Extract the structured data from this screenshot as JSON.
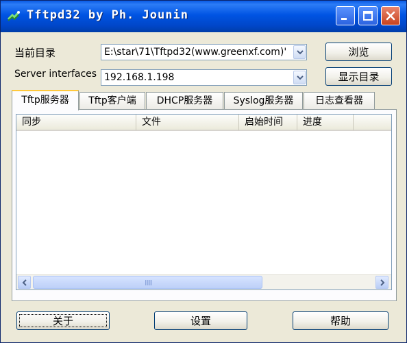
{
  "window": {
    "title": "Tftpd32 by Ph. Jounin",
    "icon": "tftpd-app-icon",
    "controls": [
      "minimize-icon",
      "maximize-icon",
      "close-icon"
    ]
  },
  "directory": {
    "label": "当前目录",
    "value": "E:\\star\\71\\Tftpd32(www.greenxf.com)'",
    "browse_label": "浏览"
  },
  "interfaces": {
    "label": "Server interfaces",
    "value": "192.168.1.198",
    "show_dir_label": "显示目录"
  },
  "tabs": [
    {
      "label": "Tftp服务器",
      "active": true
    },
    {
      "label": "Tftp客户端",
      "active": false
    },
    {
      "label": "DHCP服务器",
      "active": false
    },
    {
      "label": "Syslog服务器",
      "active": false
    },
    {
      "label": "日志查看器",
      "active": false
    }
  ],
  "table": {
    "columns": [
      "同步",
      "文件",
      "启始时间",
      "进度"
    ],
    "rows": []
  },
  "footer": {
    "about_label": "关于",
    "settings_label": "设置",
    "help_label": "帮助"
  },
  "colors": {
    "titlebar": "#0054e3",
    "window_bg": "#ece9d8",
    "active_tab_accent": "#ffc83c",
    "close_button": "#d9532a"
  }
}
